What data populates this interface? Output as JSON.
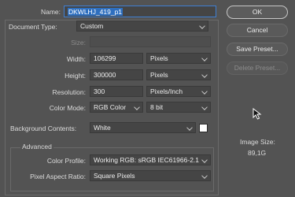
{
  "name": {
    "label": "Name:",
    "value": "DKWLHJ_419_p1"
  },
  "document_type": {
    "label": "Document Type:",
    "value": "Custom"
  },
  "size": {
    "label": "Size:",
    "value": ""
  },
  "width": {
    "label": "Width:",
    "value": "106299",
    "unit": "Pixels"
  },
  "height": {
    "label": "Height:",
    "value": "300000",
    "unit": "Pixels"
  },
  "resolution": {
    "label": "Resolution:",
    "value": "300",
    "unit": "Pixels/Inch"
  },
  "color_mode": {
    "label": "Color Mode:",
    "value": "RGB Color",
    "depth": "8 bit"
  },
  "background_contents": {
    "label": "Background Contents:",
    "value": "White",
    "swatch_color": "#ffffff"
  },
  "advanced": {
    "title": "Advanced",
    "color_profile": {
      "label": "Color Profile:",
      "value": "Working RGB:  sRGB IEC61966-2.1"
    },
    "pixel_aspect_ratio": {
      "label": "Pixel Aspect Ratio:",
      "value": "Square Pixels"
    }
  },
  "buttons": {
    "ok": "OK",
    "cancel": "Cancel",
    "save_preset": "Save Preset...",
    "delete_preset": "Delete Preset..."
  },
  "image_size": {
    "label": "Image Size:",
    "value": "89,1G"
  },
  "colors": {
    "background": "#535353",
    "field": "#454545",
    "selection": "#2e6fbf",
    "focus": "#3f7fd2"
  }
}
